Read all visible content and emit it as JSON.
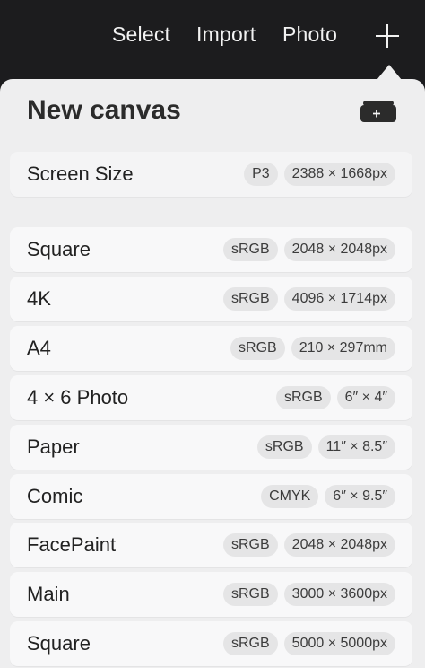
{
  "topbar": {
    "select_label": "Select",
    "import_label": "Import",
    "photo_label": "Photo",
    "add_icon": "plus-icon"
  },
  "panel": {
    "title": "New canvas",
    "new_canvas_icon": "new-canvas-icon"
  },
  "presets": [
    {
      "name": "Screen Size",
      "profile": "P3",
      "size": "2388 × 1668px"
    },
    {
      "name": "Square",
      "profile": "sRGB",
      "size": "2048 × 2048px"
    },
    {
      "name": "4K",
      "profile": "sRGB",
      "size": "4096 × 1714px"
    },
    {
      "name": "A4",
      "profile": "sRGB",
      "size": "210 × 297mm"
    },
    {
      "name": "4 × 6 Photo",
      "profile": "sRGB",
      "size": "6″ × 4″"
    },
    {
      "name": "Paper",
      "profile": "sRGB",
      "size": "11″ × 8.5″"
    },
    {
      "name": "Comic",
      "profile": "CMYK",
      "size": "6″ × 9.5″"
    },
    {
      "name": "FacePaint",
      "profile": "sRGB",
      "size": "2048 × 2048px"
    },
    {
      "name": "Main",
      "profile": "sRGB",
      "size": "3000 × 3600px"
    },
    {
      "name": "Square",
      "profile": "sRGB",
      "size": "5000 × 5000px"
    }
  ],
  "colors": {
    "topbar_bg": "#1c1c1e",
    "panel_bg": "#eeeeef",
    "row_bg": "#f8f8f9",
    "tag_bg": "#e5e5e6"
  }
}
